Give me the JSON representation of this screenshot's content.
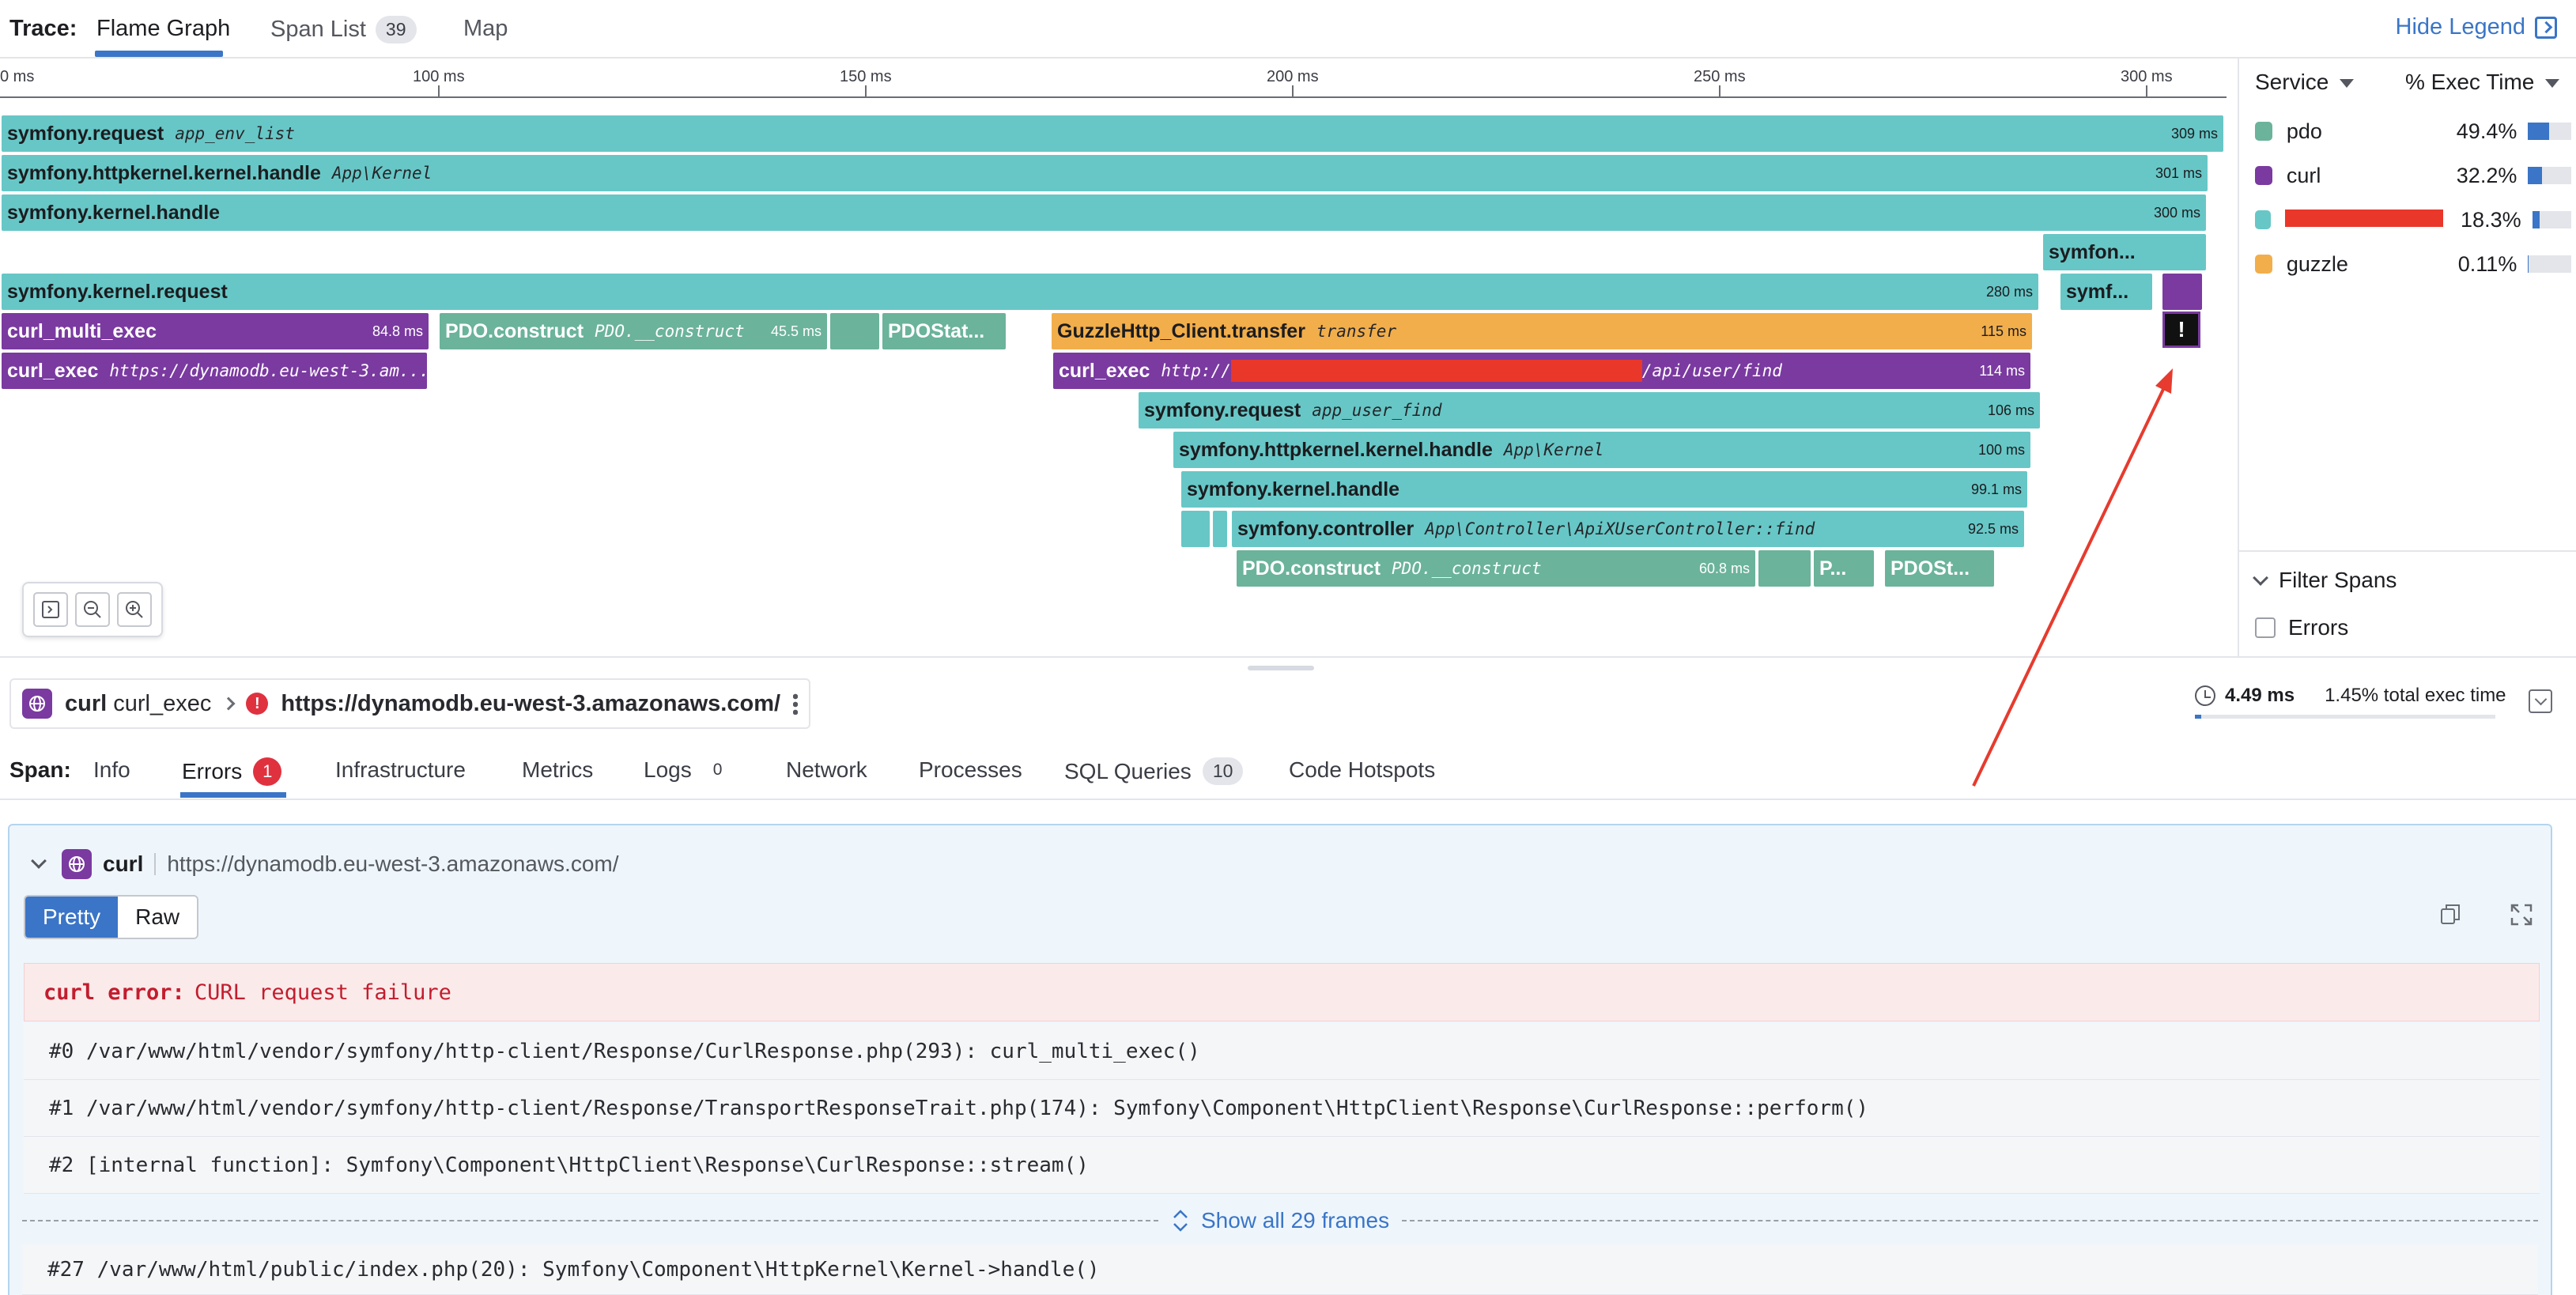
{
  "topbar": {
    "trace_label": "Trace:",
    "tabs": [
      {
        "label": "Flame Graph"
      },
      {
        "label": "Span List",
        "badge": "39"
      },
      {
        "label": "Map"
      }
    ],
    "hide_legend": "Hide Legend"
  },
  "ruler": {
    "ticks": [
      "0 ms",
      "100 ms",
      "150 ms",
      "200 ms",
      "250 ms",
      "300 ms"
    ]
  },
  "flame": {
    "frames": [
      {
        "name": "symfony.request",
        "resource": "app_env_list",
        "duration": "309 ms"
      },
      {
        "name": "symfony.httpkernel.kernel.handle",
        "resource": "App\\Kernel",
        "duration": "301 ms"
      },
      {
        "name": "symfony.kernel.handle",
        "resource": "",
        "duration": "300 ms"
      },
      {
        "name": "symfon...",
        "resource": "",
        "duration": ""
      },
      {
        "name": "symfony.kernel.request",
        "resource": "",
        "duration": "280 ms"
      },
      {
        "name": "symf...",
        "resource": "",
        "duration": ""
      },
      {
        "name": "curl_multi_exec",
        "resource": "",
        "duration": "84.8 ms"
      },
      {
        "name": "PDO.construct",
        "resource": "PDO.__construct",
        "duration": "45.5 ms"
      },
      {
        "name": "PDOStat...",
        "resource": "",
        "duration": ""
      },
      {
        "name": "GuzzleHttp_Client.transfer",
        "resource": "transfer",
        "duration": "115 ms"
      },
      {
        "name": "curl_exec",
        "resource": "https://dynamodb.eu-west-3.am...",
        "duration": ""
      },
      {
        "name": "curl_exec",
        "resource_prefix": "http://",
        "resource_suffix": "/api/user/find",
        "duration": "114 ms"
      },
      {
        "name": "symfony.request",
        "resource": "app_user_find",
        "duration": "106 ms"
      },
      {
        "name": "symfony.httpkernel.kernel.handle",
        "resource": "App\\Kernel",
        "duration": "100 ms"
      },
      {
        "name": "symfony.kernel.handle",
        "resource": "",
        "duration": "99.1 ms"
      },
      {
        "name": "symfony.controller",
        "resource": "App\\Controller\\ApiXUserController::find",
        "duration": "92.5 ms"
      },
      {
        "name": "PDO.construct",
        "resource": "PDO.__construct",
        "duration": "60.8 ms"
      },
      {
        "name": "P...",
        "resource": "",
        "duration": ""
      },
      {
        "name": "PDOSt...",
        "resource": "",
        "duration": ""
      }
    ],
    "error_marker": "!"
  },
  "legend": {
    "service_header": "Service",
    "exec_header": "% Exec Time",
    "rows": [
      {
        "name": "pdo",
        "pct": "49.4%",
        "fill": 0.494,
        "color": "#6bb39b"
      },
      {
        "name": "curl",
        "pct": "32.2%",
        "fill": 0.322,
        "color": "#7a3aa0"
      },
      {
        "name": "",
        "pct": "18.3%",
        "fill": 0.183,
        "color": "#67c7c6"
      },
      {
        "name": "guzzle",
        "pct": "0.11%",
        "fill": 0.0011,
        "color": "#f2ae4b"
      }
    ],
    "filter_title": "Filter Spans",
    "errors_checkbox": "Errors"
  },
  "span": {
    "service": "curl",
    "operation": "curl_exec",
    "resource": "https://dynamodb.eu-west-3.amazonaws.com/",
    "duration": "4.49 ms",
    "total_exec": "1.45% total exec time",
    "exec_fraction": 0.0145,
    "label": "Span:",
    "tabs": [
      {
        "label": "Info"
      },
      {
        "label": "Errors",
        "count": "1"
      },
      {
        "label": "Infrastructure"
      },
      {
        "label": "Metrics"
      },
      {
        "label": "Logs",
        "count": "0"
      },
      {
        "label": "Network"
      },
      {
        "label": "Processes"
      },
      {
        "label": "SQL Queries",
        "count": "10"
      },
      {
        "label": "Code Hotspots"
      }
    ]
  },
  "error": {
    "service": "curl",
    "url": "https://dynamodb.eu-west-3.amazonaws.com/",
    "pretty": "Pretty",
    "raw": "Raw",
    "title_prefix": "curl error:",
    "title_msg": "CURL request failure",
    "stack": [
      "#0 /var/www/html/vendor/symfony/http-client/Response/CurlResponse.php(293): curl_multi_exec()",
      "#1 /var/www/html/vendor/symfony/http-client/Response/TransportResponseTrait.php(174): Symfony\\Component\\HttpClient\\Response\\CurlResponse::perform()",
      "#2 [internal function]: Symfony\\Component\\HttpClient\\Response\\CurlResponse::stream()"
    ],
    "show_all": "Show all 29 frames",
    "last_frame": "#27 /var/www/html/public/index.php(20): Symfony\\Component\\HttpKernel\\Kernel->handle()"
  }
}
